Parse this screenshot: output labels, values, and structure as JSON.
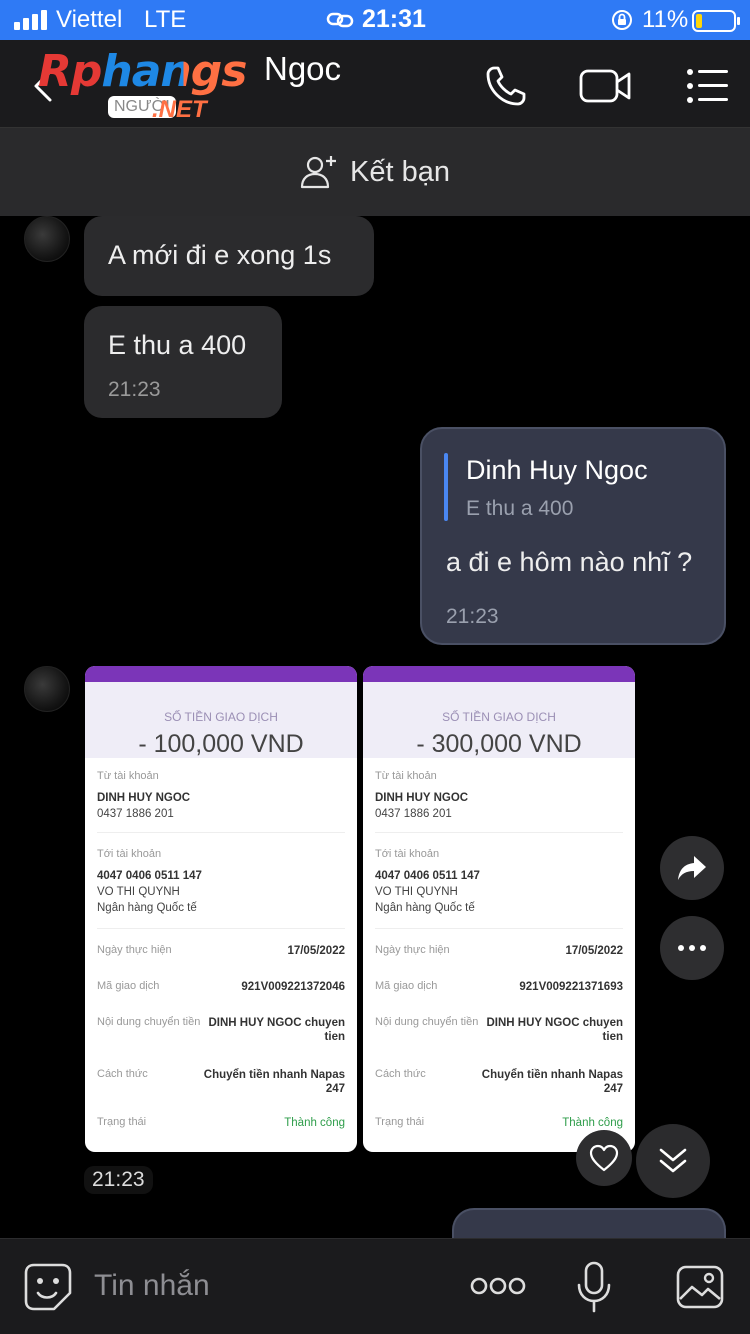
{
  "status_bar": {
    "carrier": "Viettel",
    "network": "LTE",
    "time": "21:31",
    "battery_percent": "11%",
    "battery_level": 0.11
  },
  "header": {
    "contact_name": "Ngoc",
    "watermark": "Rphangs",
    "watermark_sub": "NGƯỜI",
    "watermark_net": ".NET"
  },
  "friend_bar": {
    "label": "Kết bạn"
  },
  "messages": {
    "recv1": {
      "text": "A mới đi e xong 1s"
    },
    "recv2": {
      "text": "E thu a 400",
      "time": "21:23"
    },
    "sent1": {
      "quote_name": "Dinh Huy Ngoc",
      "quote_text": "E thu a 400",
      "text": "a đi e hôm nào nhĩ ?",
      "time": "21:23"
    },
    "images_time": "21:23"
  },
  "receipts": [
    {
      "hero_label": "SỐ TIỀN GIAO DỊCH",
      "amount": "- 100,000 VND",
      "from_label": "Từ tài khoản",
      "from_name": "DINH HUY NGOC",
      "from_account": "0437 1886 201",
      "to_label": "Tới tài khoản",
      "to_account": "4047 0406 0511 147",
      "to_name": "VO THI QUYNH",
      "to_bank": "Ngân hàng Quốc tế",
      "date_label": "Ngày thực hiện",
      "date": "17/05/2022",
      "code_label": "Mã giao dịch",
      "code": "921V009221372046",
      "content_label": "Nội dung chuyển tiền",
      "content": "DINH HUY NGOC chuyen tien",
      "method_label": "Cách thức",
      "method": "Chuyển tiền nhanh Napas 247",
      "status_label": "Trạng thái",
      "status": "Thành công"
    },
    {
      "hero_label": "SỐ TIỀN GIAO DỊCH",
      "amount": "- 300,000 VND",
      "from_label": "Từ tài khoản",
      "from_name": "DINH HUY NGOC",
      "from_account": "0437 1886 201",
      "to_label": "Tới tài khoản",
      "to_account": "4047 0406 0511 147",
      "to_name": "VO THI QUYNH",
      "to_bank": "Ngân hàng Quốc tế",
      "date_label": "Ngày thực hiện",
      "date": "17/05/2022",
      "code_label": "Mã giao dịch",
      "code": "921V009221371693",
      "content_label": "Nội dung chuyển tiền",
      "content": "DINH HUY NGOC chuyen tien",
      "method_label": "Cách thức",
      "method": "Chuyển tiền nhanh Napas 247",
      "status_label": "Trạng thái",
      "status": "Thành công"
    }
  ],
  "composer": {
    "placeholder": "Tin nhắn"
  },
  "colors": {
    "status_bar": "#2f7af5",
    "header": "#1b1b1d",
    "bubble_recv": "#2b2b2d",
    "bubble_sent": "#35394a",
    "quote_accent": "#4a87f2",
    "receipt_accent": "#7b35b8",
    "success": "#2e9d4a"
  }
}
